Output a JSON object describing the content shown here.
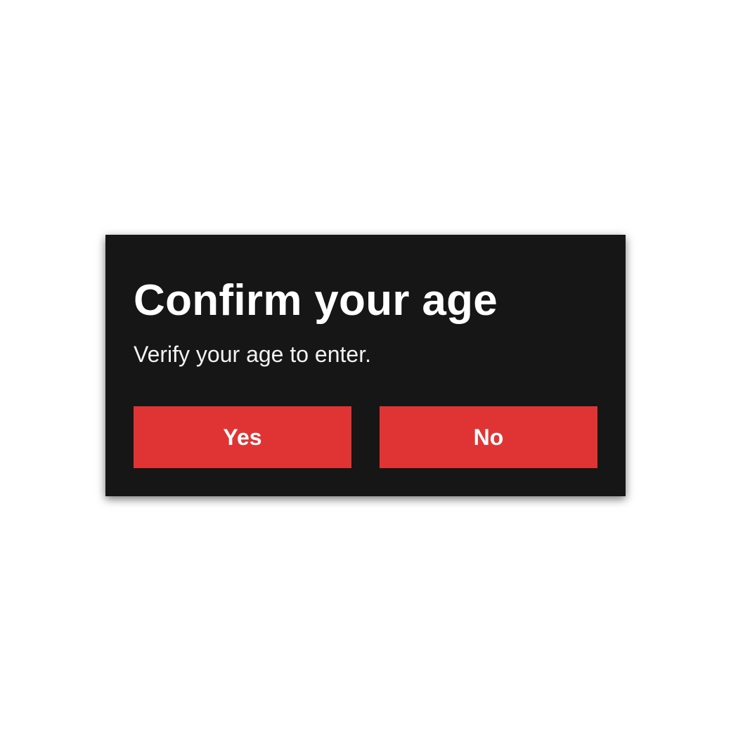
{
  "dialog": {
    "title": "Confirm your age",
    "message": "Verify your age to enter.",
    "yes_label": "Yes",
    "no_label": "No"
  },
  "colors": {
    "page_background": "#ffffff",
    "dialog_background": "#161616",
    "button_background": "#e03434",
    "text": "#ffffff"
  }
}
